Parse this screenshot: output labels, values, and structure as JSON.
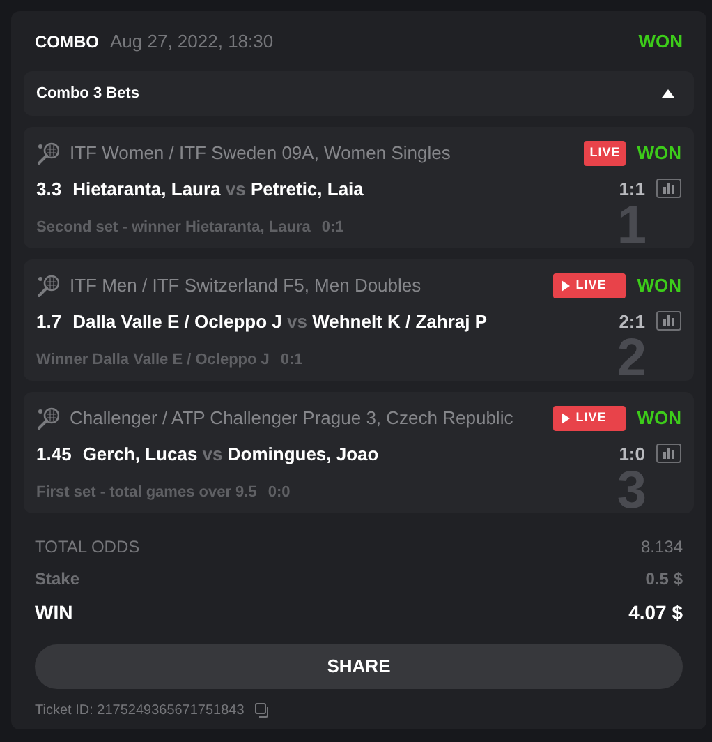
{
  "header": {
    "type": "COMBO",
    "date": "Aug 27, 2022, 18:30",
    "status": "WON"
  },
  "group": {
    "title": "Combo 3 Bets",
    "expanded": true
  },
  "bets": [
    {
      "number": "1",
      "league": "ITF Women / ITF Sweden 09A, Women Singles",
      "live": "LIVE",
      "stream": false,
      "status": "WON",
      "odds": "3.3",
      "home": "Hietaranta, Laura",
      "vs": "vs",
      "away": "Petretic, Laia",
      "score": "1:1",
      "market": "Second set - winner Hietaranta, Laura",
      "market_score": "0:1"
    },
    {
      "number": "2",
      "league": "ITF Men / ITF Switzerland F5, Men Doubles",
      "live": "LIVE",
      "stream": true,
      "status": "WON",
      "odds": "1.7",
      "home": "Dalla Valle E / Ocleppo J",
      "vs": "vs",
      "away": "Wehnelt K / Zahraj P",
      "score": "2:1",
      "market": "Winner Dalla Valle E / Ocleppo J",
      "market_score": "0:1"
    },
    {
      "number": "3",
      "league": "Challenger / ATP Challenger Prague 3, Czech Republic",
      "live": "LIVE",
      "stream": true,
      "status": "WON",
      "odds": "1.45",
      "home": "Gerch, Lucas",
      "vs": "vs",
      "away": "Domingues, Joao",
      "score": "1:0",
      "market": "First set - total games over 9.5",
      "market_score": "0:0"
    }
  ],
  "totals": [
    {
      "kind": "odds",
      "label": "TOTAL ODDS",
      "value": "8.134"
    },
    {
      "kind": "stake",
      "label": "Stake",
      "value": "0.5 $"
    },
    {
      "kind": "win",
      "label": "WIN",
      "value": "4.07 $"
    }
  ],
  "share_button": "SHARE",
  "ticket": "Ticket ID: 2175249365671751843"
}
